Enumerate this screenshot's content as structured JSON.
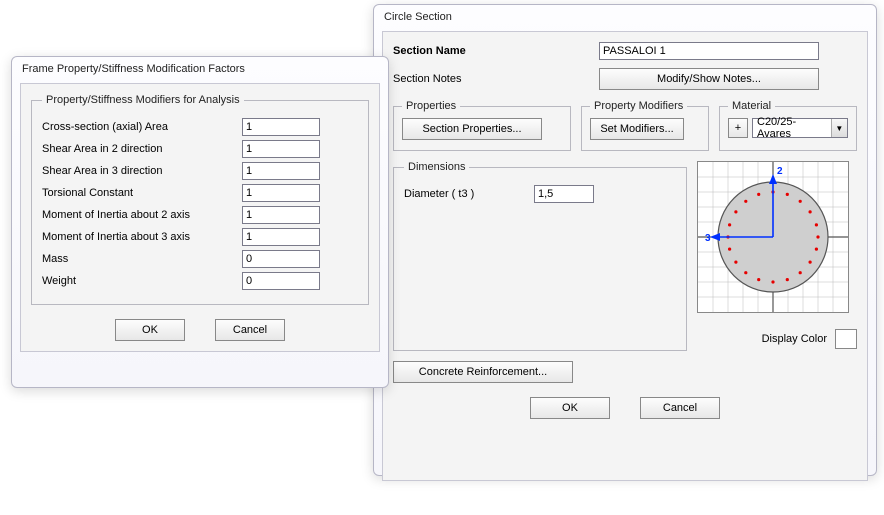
{
  "frame_dialog": {
    "title": "Frame Property/Stiffness Modification Factors",
    "group_title": "Property/Stiffness Modifiers for Analysis",
    "fields": {
      "cross_section": {
        "label": "Cross-section (axial) Area",
        "value": "1"
      },
      "shear2": {
        "label": "Shear Area in 2 direction",
        "value": "1"
      },
      "shear3": {
        "label": "Shear Area in 3 direction",
        "value": "1"
      },
      "torsional": {
        "label": "Torsional Constant",
        "value": "1"
      },
      "moi2": {
        "label": "Moment of Inertia about 2 axis",
        "value": "1"
      },
      "moi3": {
        "label": "Moment of Inertia about 3 axis",
        "value": "1"
      },
      "mass": {
        "label": "Mass",
        "value": "0"
      },
      "weight": {
        "label": "Weight",
        "value": "0"
      }
    },
    "ok": "OK",
    "cancel": "Cancel"
  },
  "circle_dialog": {
    "title": "Circle Section",
    "section_name_label": "Section Name",
    "section_name_value": "PASSALOI 1",
    "section_notes_label": "Section Notes",
    "modify_show_notes": "Modify/Show Notes...",
    "properties_group": "Properties",
    "section_properties_btn": "Section Properties...",
    "property_modifiers_group": "Property Modifiers",
    "set_modifiers_btn": "Set Modifiers...",
    "material_group": "Material",
    "material_value": "C20/25-Avares",
    "dimensions_group": "Dimensions",
    "diameter_label": "Diameter  ( t3 )",
    "diameter_value": "1,5",
    "display_color_label": "Display Color",
    "concrete_reinforcement_btn": "Concrete Reinforcement...",
    "ok": "OK",
    "cancel": "Cancel",
    "preview": {
      "axis2": "2",
      "axis3": "3"
    }
  }
}
